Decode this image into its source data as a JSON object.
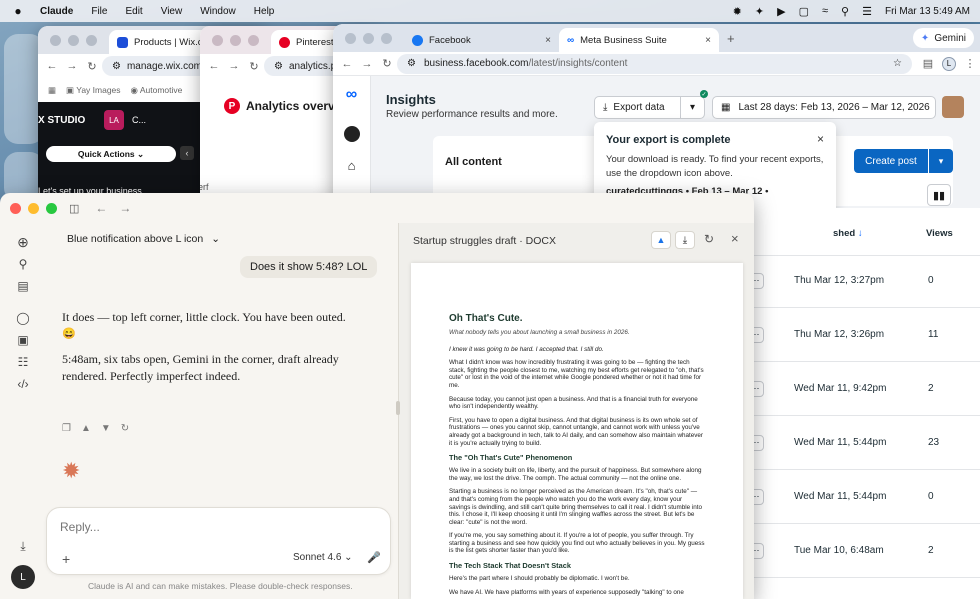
{
  "menubar": {
    "app": "Claude",
    "items": [
      "File",
      "Edit",
      "View",
      "Window",
      "Help"
    ],
    "datetime": "Fri Mar 13  5:49 AM"
  },
  "wix": {
    "tab": "Products | Wix.com",
    "url": "manage.wix.com",
    "bookmarks": [
      "Yay Images",
      "Automotive"
    ],
    "studio": "X STUDIO",
    "avatar": "LA",
    "menu_c": "C...",
    "quick_actions": "Quick Actions",
    "setup": "Let's set up your business"
  },
  "pinterest": {
    "tab": "Pinterest",
    "url": "analytics.pinterest.com",
    "title": "Analytics overview",
    "snippet": "erf"
  },
  "facebook": {
    "tabs": [
      "Facebook",
      "Meta Business Suite"
    ],
    "url_host": "business.facebook.com",
    "url_path": "/latest/insights/content",
    "profile": "L",
    "gemini": "Gemini"
  },
  "meta": {
    "title": "Insights",
    "subtitle": "Review performance results and more.",
    "export": "Export data",
    "date_range": "Last 28 days: Feb 13, 2026 – Mar 12, 2026",
    "all_content": "All content",
    "create_post": "Create post",
    "toast_title": "Your export is complete",
    "toast_body": "Your download is ready. To find your recent exports, use the dropdown icon above.",
    "toast_file": "curatedcuttinggs • Feb 13 – Mar 12 •",
    "col_published": "shed",
    "col_views": "Views",
    "rows": [
      {
        "date": "Thu Mar 12, 3:27pm",
        "views": "0"
      },
      {
        "date": "Thu Mar 12, 3:26pm",
        "views": "11"
      },
      {
        "date": "Wed Mar 11, 9:42pm",
        "views": "2"
      },
      {
        "date": "Wed Mar 11, 5:44pm",
        "views": "23"
      },
      {
        "date": "Wed Mar 11, 5:44pm",
        "views": "0"
      },
      {
        "date": "Tue Mar 10, 6:48am",
        "views": "2"
      }
    ]
  },
  "claude": {
    "conversation_title": "Blue notification above L icon",
    "user_message": "Does it show 5:48? LOL",
    "reply_p1": "It does — top left corner, little clock. You have been outed.",
    "reply_emoji": "😄",
    "reply_p2": "5:48am, six tabs open, Gemini in the corner, draft already rendered. Perfectly imperfect indeed.",
    "input_placeholder": "Reply...",
    "model": "Sonnet 4.6",
    "disclaimer": "Claude is AI and can make mistakes. Please double-check responses.",
    "user_initial": "L",
    "doc_title": "Startup struggles draft",
    "doc_type": "DOCX"
  },
  "document": {
    "h1": "Oh That's Cute.",
    "subtitle": "What nobody tells you about launching a small business in 2026.",
    "p1": "I knew it was going to be hard. I accepted that. I still do.",
    "p2": "What I didn't know was how incredibly frustrating it was going to be — fighting the tech stack, fighting the people closest to me, watching my best efforts get relegated to \"oh, that's cute\" or lost in the void of the internet while Google pondered whether or not it had time for me.",
    "p3": "Because today, you cannot just open a business. And that is a financial truth for everyone who isn't independently wealthy.",
    "p4": "First, you have to open a digital business. And that digital business is its own whole set of frustrations — ones you cannot skip, cannot untangle, and cannot work with unless you've already got a background in tech, talk to AI daily, and can somehow also maintain whatever it is you're actually trying to build.",
    "h2a": "The \"Oh That's Cute\" Phenomenon",
    "p5": "We live in a society built on life, liberty, and the pursuit of happiness. But somewhere along the way, we lost the drive. The oomph. The actual community — not the online one.",
    "p6": "Starting a business is no longer perceived as the American dream. It's \"oh, that's cute\" — and that's coming from the people who watch you do the work every day, know your savings is dwindling, and still can't quite bring themselves to call it real. I didn't stumble into this. I chose it, I'll keep choosing it until I'm slinging waffles across the street. But let's be clear: \"cute\" is not the word.",
    "p7": "If you're me, you say something about it. If you're a lot of people, you suffer through. Try starting a business and see how quickly you find out who actually believes in you. My guess is the list gets shorter faster than you'd like.",
    "h2b": "The Tech Stack That Doesn't Stack",
    "p8": "Here's the part where I should probably be diplomatic. I won't be.",
    "p9": "We have AI. We have platforms with years of experience supposedly \"talking\" to one"
  }
}
